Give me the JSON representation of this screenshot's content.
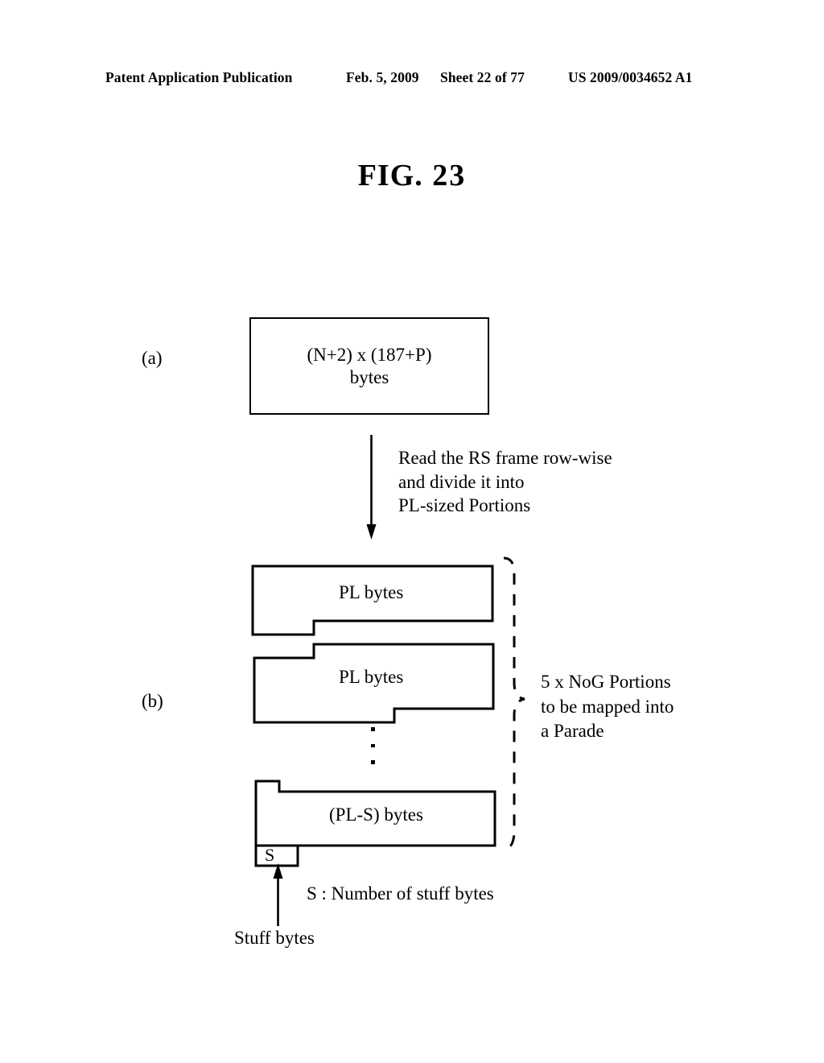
{
  "header": {
    "publication": "Patent Application Publication",
    "date": "Feb. 5, 2009",
    "sheet": "Sheet 22 of 77",
    "patent_number": "US 2009/0034652 A1"
  },
  "figure": {
    "title_word": "FIG.",
    "title_number": "23"
  },
  "part_a": {
    "label": "(a)",
    "box_line1": "(N+2)  x (187+P)",
    "box_line2": "bytes"
  },
  "transition": {
    "note_line1": "Read the RS frame row-wise",
    "note_line2": "and divide it into",
    "note_line3": "PL-sized Portions"
  },
  "part_b": {
    "label": "(b)",
    "portion_1_label": "PL bytes",
    "portion_2_label": "PL bytes",
    "portion_3_label": "(PL-S) bytes",
    "stuff_box_label": "S",
    "brace_note_line1": "5 x NoG Portions",
    "brace_note_line2": "to be mapped into",
    "brace_note_line3": "a Parade",
    "stuff_bytes_label": "Stuff bytes",
    "s_definition": "S : Number of stuff bytes"
  },
  "colors": {
    "ink": "#000000",
    "paper": "#ffffff"
  }
}
